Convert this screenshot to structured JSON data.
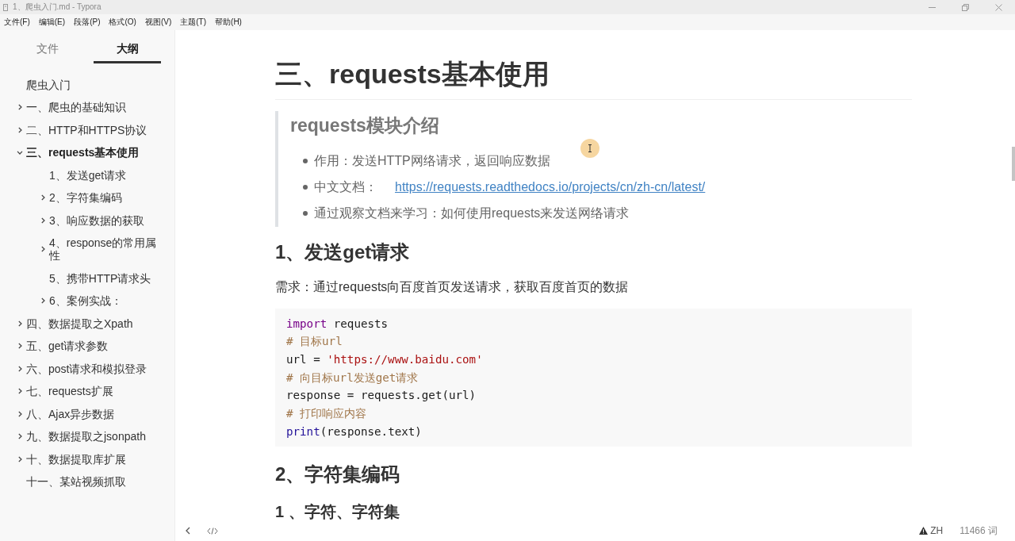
{
  "window": {
    "title": "1、爬虫入门.md - Typora"
  },
  "menu_bar": [
    "文件(F)",
    "编辑(E)",
    "段落(P)",
    "格式(O)",
    "视图(V)",
    "主题(T)",
    "帮助(H)"
  ],
  "sidebar": {
    "tabs": [
      {
        "label": "文件",
        "selected": false
      },
      {
        "label": "大纲",
        "selected": true
      }
    ],
    "outline": [
      {
        "label": "爬虫入门",
        "selected": false
      },
      {
        "label": "一、爬虫的基础知识",
        "expanded": false,
        "selected": false
      },
      {
        "label": "二、HTTP和HTTPS协议",
        "expanded": false,
        "selected": false
      },
      {
        "label": "三、requests基本使用",
        "expanded": true,
        "selected": true,
        "children": [
          {
            "label": "1、发送get请求",
            "selected": false
          },
          {
            "label": "2、字符集编码",
            "expanded": false,
            "selected": false
          },
          {
            "label": "3、响应数据的获取",
            "expanded": false,
            "selected": false
          },
          {
            "label": "4、response的常用属性",
            "expanded": false,
            "selected": false
          },
          {
            "label": "5、携带HTTP请求头",
            "selected": false
          },
          {
            "label": "6、案例实战：",
            "expanded": false,
            "selected": false
          }
        ]
      },
      {
        "label": "四、数据提取之Xpath",
        "expanded": false,
        "selected": false
      },
      {
        "label": "五、get请求参数",
        "expanded": false,
        "selected": false
      },
      {
        "label": "六、post请求和模拟登录",
        "expanded": false,
        "selected": false
      },
      {
        "label": "七、requests扩展",
        "expanded": false,
        "selected": false
      },
      {
        "label": "八、Ajax异步数据",
        "expanded": false,
        "selected": false
      },
      {
        "label": "九、数据提取之jsonpath",
        "expanded": false,
        "selected": false
      },
      {
        "label": "十、数据提取库扩展",
        "expanded": false,
        "selected": false
      },
      {
        "label": "十一、某站视频抓取",
        "selected": false
      }
    ]
  },
  "document": {
    "blocks": [
      {
        "kind": "h1",
        "text": "三、requests基本使用"
      },
      {
        "kind": "quote",
        "heading": "requests模块介绍",
        "items": [
          {
            "text": "作用：发送HTTP网络请求，返回响应数据"
          },
          {
            "text": "中文文档：",
            "link": "https://requests.readthedocs.io/projects/cn/zh-cn/latest/"
          },
          {
            "text": "通过观察文档来学习：如何使用requests来发送网络请求"
          }
        ]
      },
      {
        "kind": "h2",
        "text": "1、发送get请求"
      },
      {
        "kind": "p",
        "text": "需求：通过requests向百度首页发送请求，获取百度首页的数据"
      },
      {
        "kind": "code",
        "lines": [
          [
            {
              "kind": "keyword",
              "text": "import"
            },
            {
              "kind": "plain",
              "text": " requests"
            }
          ],
          [
            {
              "kind": "comment",
              "text": "# 目标url"
            }
          ],
          [
            {
              "kind": "plain",
              "text": "url = "
            },
            {
              "kind": "string",
              "text": "'https://www.baidu.com'"
            }
          ],
          [
            {
              "kind": "comment",
              "text": "# 向目标url发送get请求"
            }
          ],
          [
            {
              "kind": "plain",
              "text": "response = requests.get(url)"
            }
          ],
          [
            {
              "kind": "comment",
              "text": "# 打印响应内容"
            }
          ],
          [
            {
              "kind": "builtin",
              "text": "print"
            },
            {
              "kind": "plain",
              "text": "(response.text)"
            }
          ]
        ]
      },
      {
        "kind": "h2",
        "text": "2、字符集编码"
      },
      {
        "kind": "h3",
        "text": "1 、字符、字符集"
      }
    ]
  },
  "status_bar": {
    "language": "ZH",
    "word_count": "11466 词"
  }
}
